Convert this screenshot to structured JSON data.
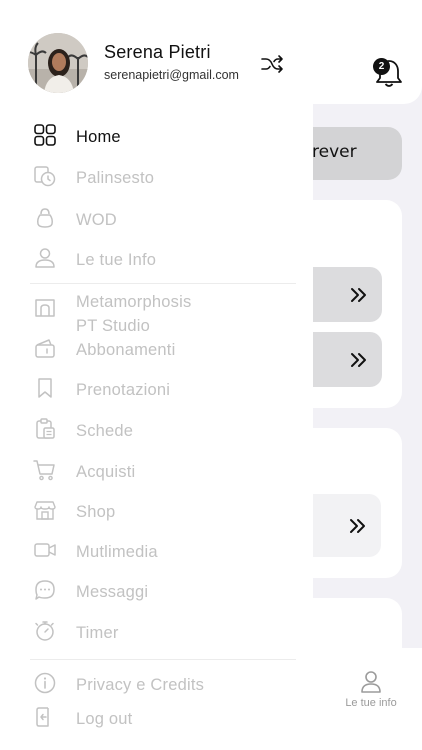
{
  "background": {
    "notification_count": "2",
    "partial_button_text": "rever",
    "bottom_tab_label": "Le tue info"
  },
  "drawer": {
    "user": {
      "name": "Serena Pietri",
      "email": "serenapietri@gmail.com"
    },
    "menu": [
      {
        "id": "home",
        "label": "Home",
        "icon": "grid-icon",
        "active": true
      },
      {
        "id": "palinsesto",
        "label": "Palinsesto",
        "icon": "schedule-icon"
      },
      {
        "id": "wod",
        "label": "WOD",
        "icon": "kettlebell-icon"
      },
      {
        "id": "info",
        "label": "Le tue Info",
        "icon": "user-icon"
      }
    ],
    "gym": {
      "line1": "Metamorphosis",
      "line2": "PT Studio"
    },
    "menu2": [
      {
        "id": "abbonamenti",
        "label": "Abbonamenti",
        "icon": "ticket-icon"
      },
      {
        "id": "prenotazioni",
        "label": "Prenotazioni",
        "icon": "bookmark-icon"
      },
      {
        "id": "schede",
        "label": "Schede",
        "icon": "clipboard-icon"
      },
      {
        "id": "acquisti",
        "label": "Acquisti",
        "icon": "cart-icon"
      },
      {
        "id": "shop",
        "label": "Shop",
        "icon": "store-icon"
      },
      {
        "id": "multimedia",
        "label": "Mutlimedia",
        "icon": "video-icon"
      },
      {
        "id": "messaggi",
        "label": "Messaggi",
        "icon": "chat-icon"
      },
      {
        "id": "timer",
        "label": "Timer",
        "icon": "stopwatch-icon"
      }
    ],
    "footer": [
      {
        "id": "privacy",
        "label": "Privacy e Credits",
        "icon": "info-icon"
      },
      {
        "id": "logout",
        "label": "Log out",
        "icon": "logout-icon"
      }
    ]
  }
}
